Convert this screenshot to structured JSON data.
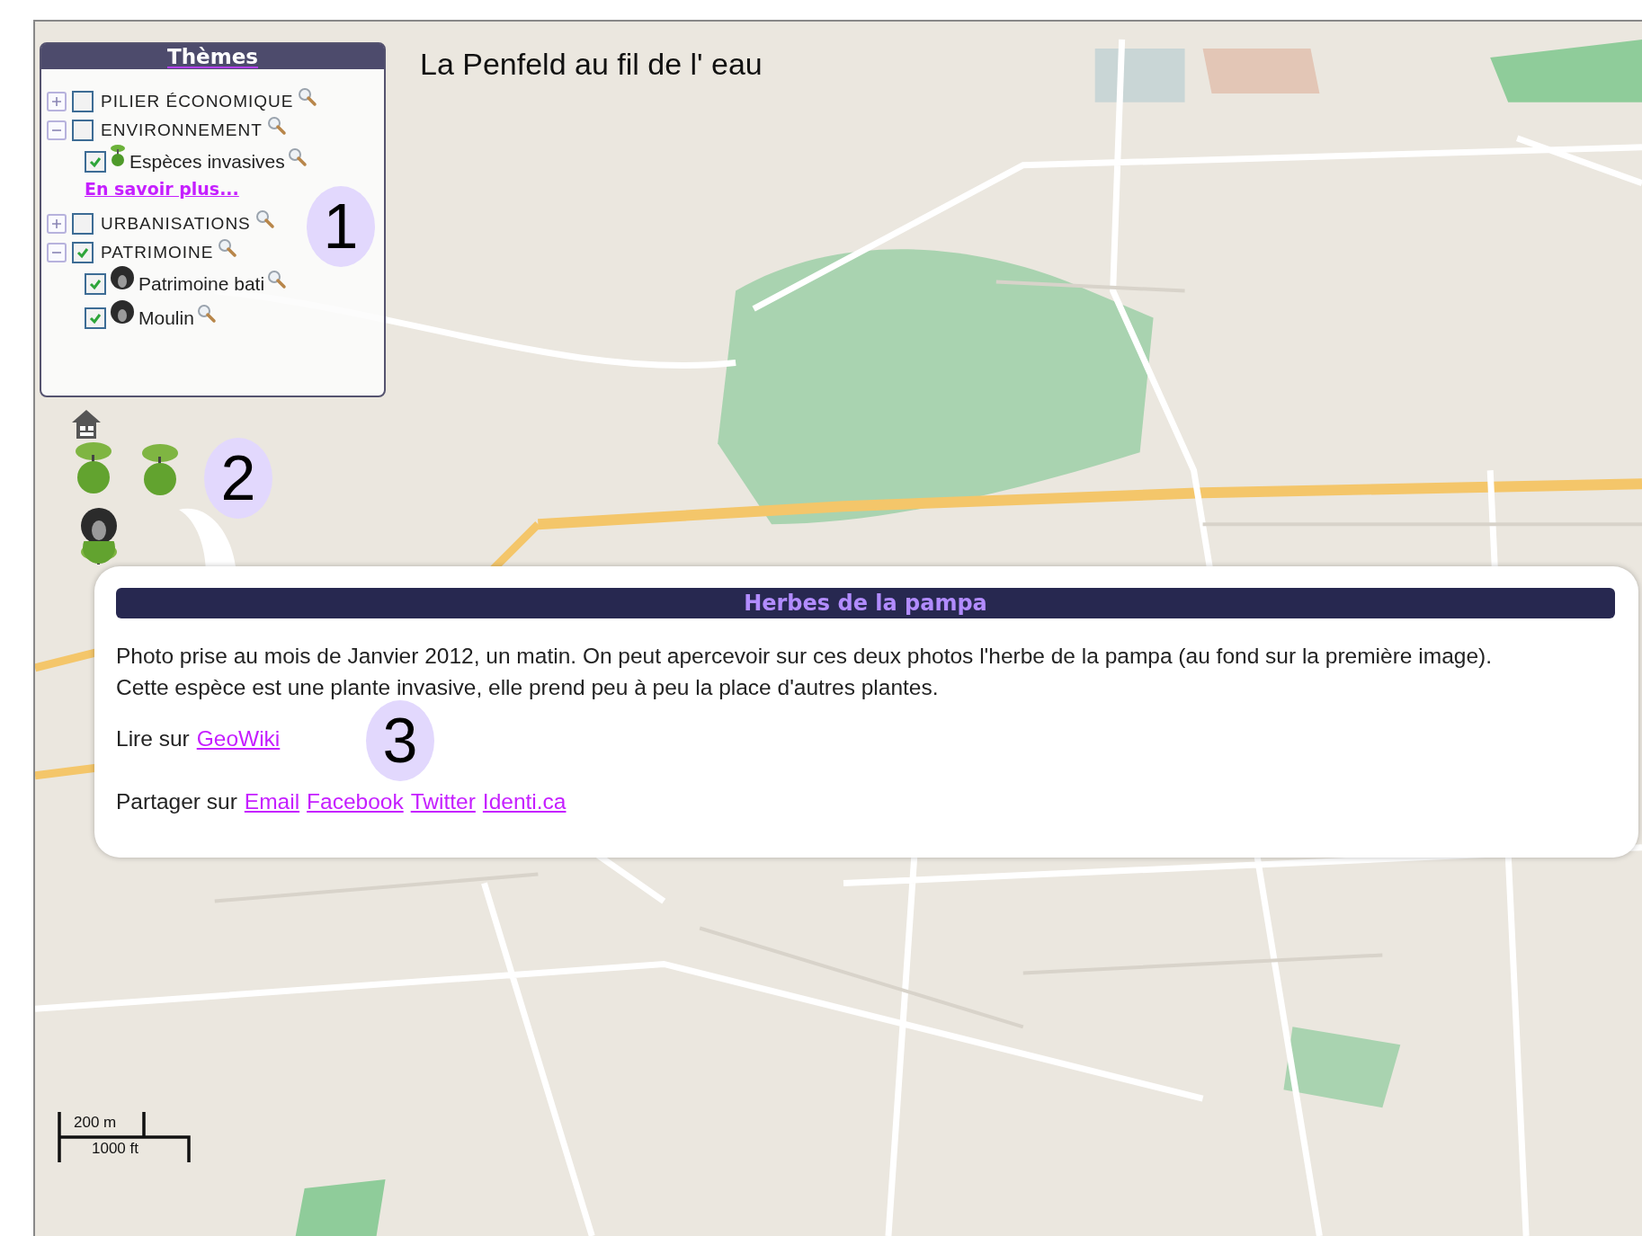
{
  "title": "La Penfeld au fil de l' eau",
  "themes": {
    "heading": "Thèmes",
    "groups": [
      {
        "label": "PILIER ÉCONOMIQUE",
        "expanded": false,
        "checked": false
      },
      {
        "label": "ENVIRONNEMENT",
        "expanded": true,
        "checked": false,
        "layers": [
          {
            "label": "Espèces invasives",
            "checked": true,
            "kind": "tree"
          }
        ],
        "link": "En savoir plus..."
      },
      {
        "label": "URBANISATIONS",
        "expanded": false,
        "checked": false
      },
      {
        "label": "PATRIMOINE",
        "expanded": true,
        "checked": true,
        "layers": [
          {
            "label": "Patrimoine bati",
            "checked": true,
            "kind": "photo"
          },
          {
            "label": "Moulin",
            "checked": true,
            "kind": "photo"
          }
        ]
      }
    ]
  },
  "markers": [
    {
      "kind": "house"
    },
    {
      "kind": "tree"
    },
    {
      "kind": "tree"
    },
    {
      "kind": "photo"
    },
    {
      "kind": "tree"
    }
  ],
  "callouts": [
    "1",
    "2",
    "3"
  ],
  "popup": {
    "title": "Herbes de la pampa",
    "text": "Photo prise au mois de Janvier 2012, un matin. On peut apercevoir sur ces deux photos l'herbe de la pampa (au fond sur la première image). Cette espèce est une plante invasive, elle prend peu à peu la place d'autres plantes.",
    "read": {
      "label": "Lire sur",
      "links": [
        "GeoWiki"
      ]
    },
    "share": {
      "label": "Partager sur",
      "links": [
        "Email",
        "Facebook",
        "Twitter",
        "Identi.ca"
      ]
    }
  },
  "scale": {
    "metric": "200 m",
    "imperial": "1000 ft"
  }
}
